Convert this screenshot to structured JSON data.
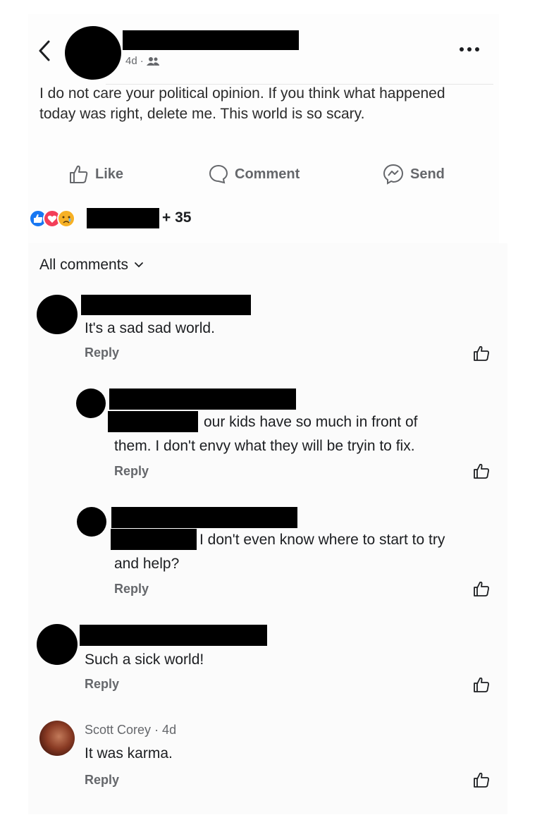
{
  "header": {
    "time": "4d",
    "sep": "·",
    "audience_icon": "friends-icon",
    "back_icon": "chevron-left-icon",
    "more_icon": "more-icon"
  },
  "post": {
    "text": "I do not care your political opinion. If you think what happened today was right, delete me. This world is so scary."
  },
  "actions": {
    "like": "Like",
    "comment": "Comment",
    "send": "Send"
  },
  "reactions": {
    "count": "+ 35",
    "icons": [
      "like-reaction-icon",
      "love-reaction-icon",
      "sad-reaction-icon"
    ]
  },
  "comments_header": {
    "label": "All comments"
  },
  "comments": [
    {
      "text": "It's a sad sad world.",
      "reply": "Reply"
    },
    {
      "text_line1": "our kids have so much in front of",
      "text_line2": "them. I don't envy what they will be tryin to fix.",
      "reply": "Reply"
    },
    {
      "text_line1": "I don't even know where to start to try",
      "text_line2": "and help?",
      "reply": "Reply"
    },
    {
      "text": "Such a sick world!",
      "reply": "Reply"
    },
    {
      "author": "Scott Corey",
      "time": "· 4d",
      "text": "It was karma.",
      "reply": "Reply"
    }
  ],
  "colors": {
    "like_blue": "#1877f2",
    "love_red": "#f33e58",
    "sad_yellow": "#f7b125",
    "muted": "#65676b"
  }
}
